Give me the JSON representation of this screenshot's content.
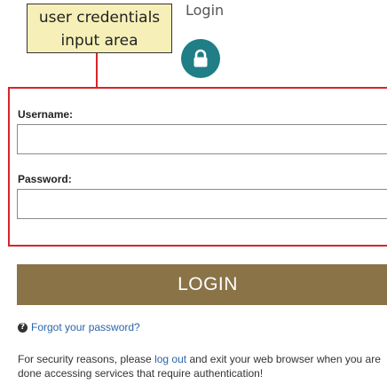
{
  "annotation": {
    "callout_line1": "user credentials",
    "callout_line2": "input area",
    "accent": "#d9232a",
    "callout_bg": "#f6f0b8"
  },
  "header": {
    "title": "Login",
    "icon": "lock-icon",
    "icon_bg": "#1f7e86"
  },
  "form": {
    "username_label": "Username:",
    "username_value": "",
    "password_label": "Password:",
    "password_value": "",
    "login_label": "LOGIN",
    "login_color": "#8a7347"
  },
  "links": {
    "forgot_icon": "help-circle-icon",
    "forgot_password": "Forgot your password?",
    "link_color": "#2b64a8"
  },
  "security": {
    "text_before": "For security reasons, please ",
    "logout_link": "log out",
    "text_after": " and exit your web browser when you are done accessing services that require authentication!"
  }
}
